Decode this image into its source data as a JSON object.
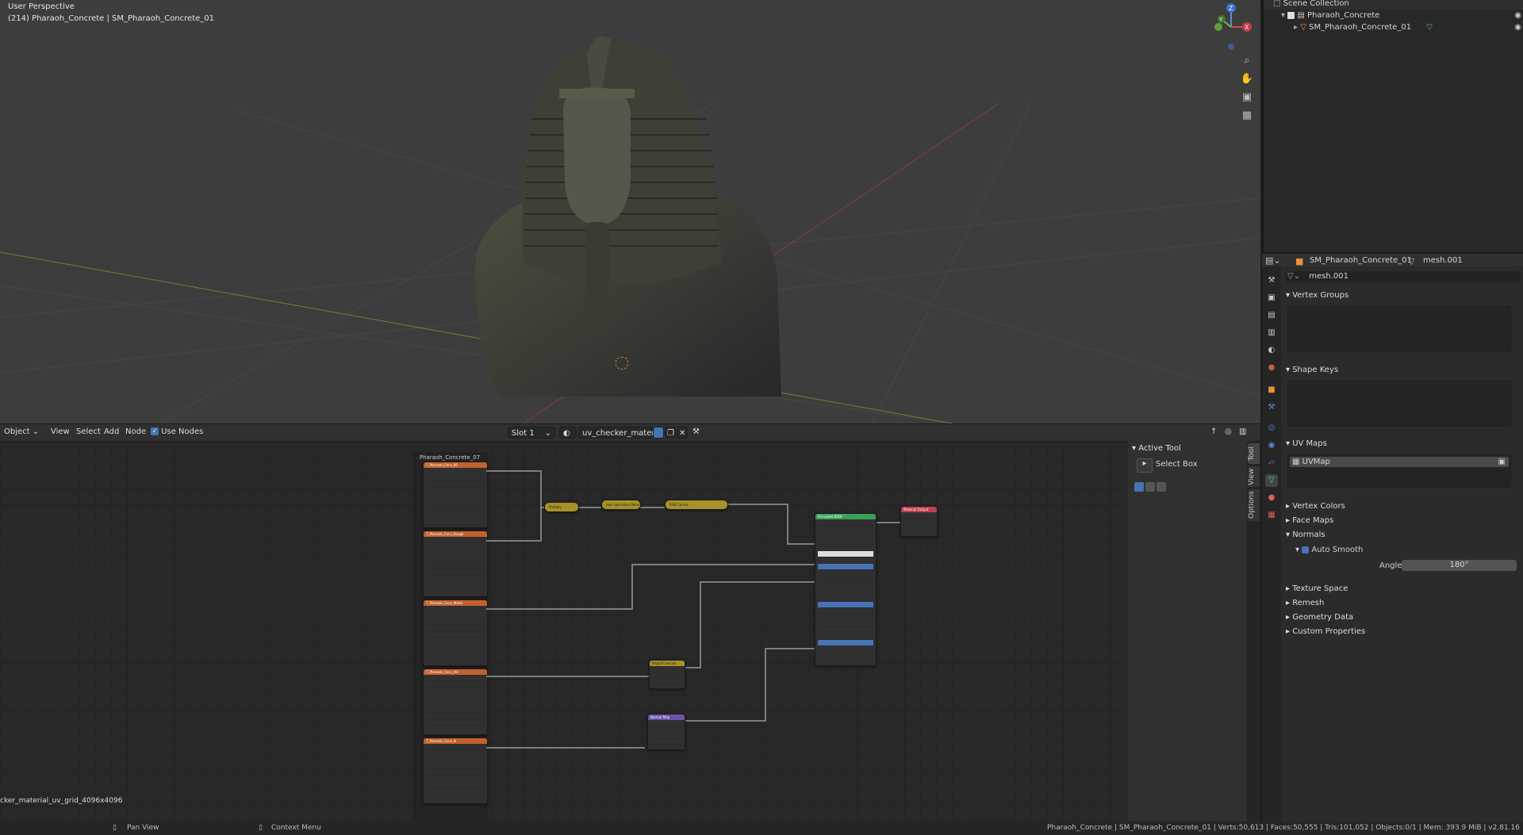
{
  "viewport": {
    "perspective_label": "User Perspective",
    "object_label": "(214) Pharaoh_Concrete | SM_Pharaoh_Concrete_01",
    "gizmo_axes": [
      "Z",
      "Y",
      "X"
    ],
    "nav_icons": [
      "zoom-icon",
      "hand-icon",
      "camera-icon",
      "grid-icon"
    ]
  },
  "node_header": {
    "mode": "Object",
    "menus": [
      "View",
      "Select",
      "Add",
      "Node"
    ],
    "use_nodes_label": "Use Nodes",
    "use_nodes_checked": true,
    "slot": "Slot 1",
    "material_name": "uv_checker_materia..."
  },
  "node_editor": {
    "frame_title": "Pharaoh_Concrete_07",
    "image_label": "cker_material_uv_grid_4096x4096",
    "texture_nodes": [
      "T_Pharaoh_Conc_BC",
      "T_Pharaoh_Conc_Rough",
      "T_Pharaoh_Conc_Metal",
      "T_Pharaoh_Conc_AO",
      "T_Pharaoh_Conc_N"
    ],
    "principled_label": "Principled BSDF",
    "output_label": "Material Output",
    "bright_contrast_label": "Bright/Contrast",
    "normal_map_label": "Normal Map",
    "mix_nodes": [
      "Multiply",
      "Hue Saturation Value",
      "RGB Curves"
    ]
  },
  "npanel": {
    "title": "Active Tool",
    "tool_name": "Select Box",
    "tabs": [
      "Tool",
      "View",
      "Options"
    ]
  },
  "outliner": {
    "scene_collection": "Scene Collection",
    "collection": "Pharaoh_Concrete",
    "object": "SM_Pharaoh_Concrete_01"
  },
  "properties": {
    "object_name": "SM_Pharaoh_Concrete_01",
    "mesh_name": "mesh.001",
    "mesh_field": "mesh.001",
    "panels": {
      "vertex_groups": "Vertex Groups",
      "shape_keys": "Shape Keys",
      "uv_maps": "UV Maps",
      "uv_map_item": "UVMap",
      "vertex_colors": "Vertex Colors",
      "face_maps": "Face Maps",
      "normals": "Normals",
      "auto_smooth": "Auto Smooth",
      "angle_label": "Angle",
      "angle_value": "180°",
      "texture_space": "Texture Space",
      "remesh": "Remesh",
      "geometry_data": "Geometry Data",
      "custom_properties": "Custom Properties"
    }
  },
  "statusbar": {
    "pan_view": "Pan View",
    "context_menu": "Context Menu",
    "stats": "Pharaoh_Concrete | SM_Pharaoh_Concrete_01 | Verts:50,613 | Faces:50,555 | Tris:101,052 | Objects:0/1 | Mem: 393.9 MiB | v2.81.16"
  },
  "colors": {
    "accent_blue": "#4772b3",
    "tex_node": "#c2612c",
    "mix_node": "#a69228",
    "shader_node": "#3aa05a",
    "output_node": "#bf3f4f",
    "vector_node": "#6b54a8"
  }
}
